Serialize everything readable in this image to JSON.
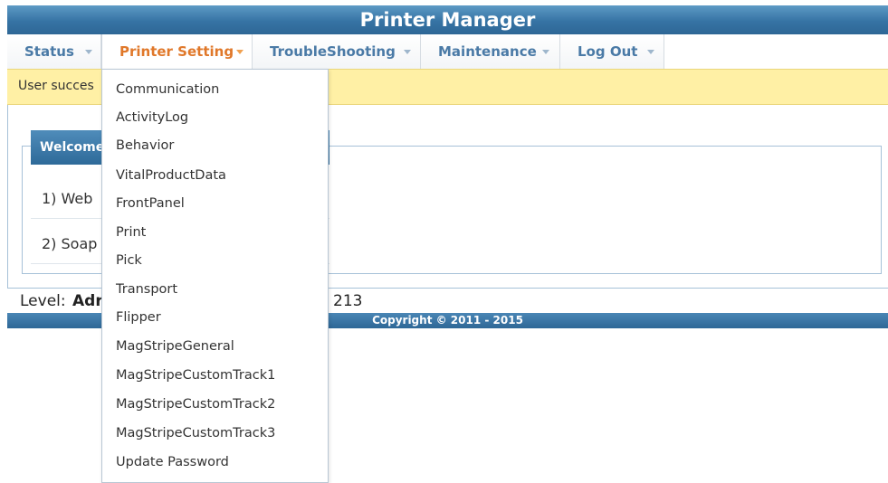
{
  "header": {
    "title": "Printer Manager"
  },
  "menubar": {
    "items": [
      {
        "label": "Status"
      },
      {
        "label": "Printer Setting"
      },
      {
        "label": "TroubleShooting"
      },
      {
        "label": "Maintenance"
      },
      {
        "label": "Log Out"
      }
    ],
    "active": "Printer Setting"
  },
  "banner": {
    "text": "User succes"
  },
  "panel": {
    "header": "Welcome",
    "rows": [
      "1) Web",
      "2) Soap"
    ]
  },
  "level": {
    "label": "Level:",
    "value": "Adr",
    "extra": "213"
  },
  "footer": {
    "copyright": "Copyright © 2011 - 2015"
  },
  "dropdown": {
    "items": [
      "Communication",
      "ActivityLog",
      "Behavior",
      "VitalProductData",
      "FrontPanel",
      "Print",
      "Pick",
      "Transport",
      "Flipper",
      "MagStripeGeneral",
      "MagStripeCustomTrack1",
      "MagStripeCustomTrack2",
      "MagStripeCustomTrack3",
      "Update Password"
    ]
  },
  "colors": {
    "header_bg": "#3673a4",
    "menu_text": "#4a7aa6",
    "menu_active_text": "#e0782a",
    "banner_bg": "#fff0a5"
  }
}
